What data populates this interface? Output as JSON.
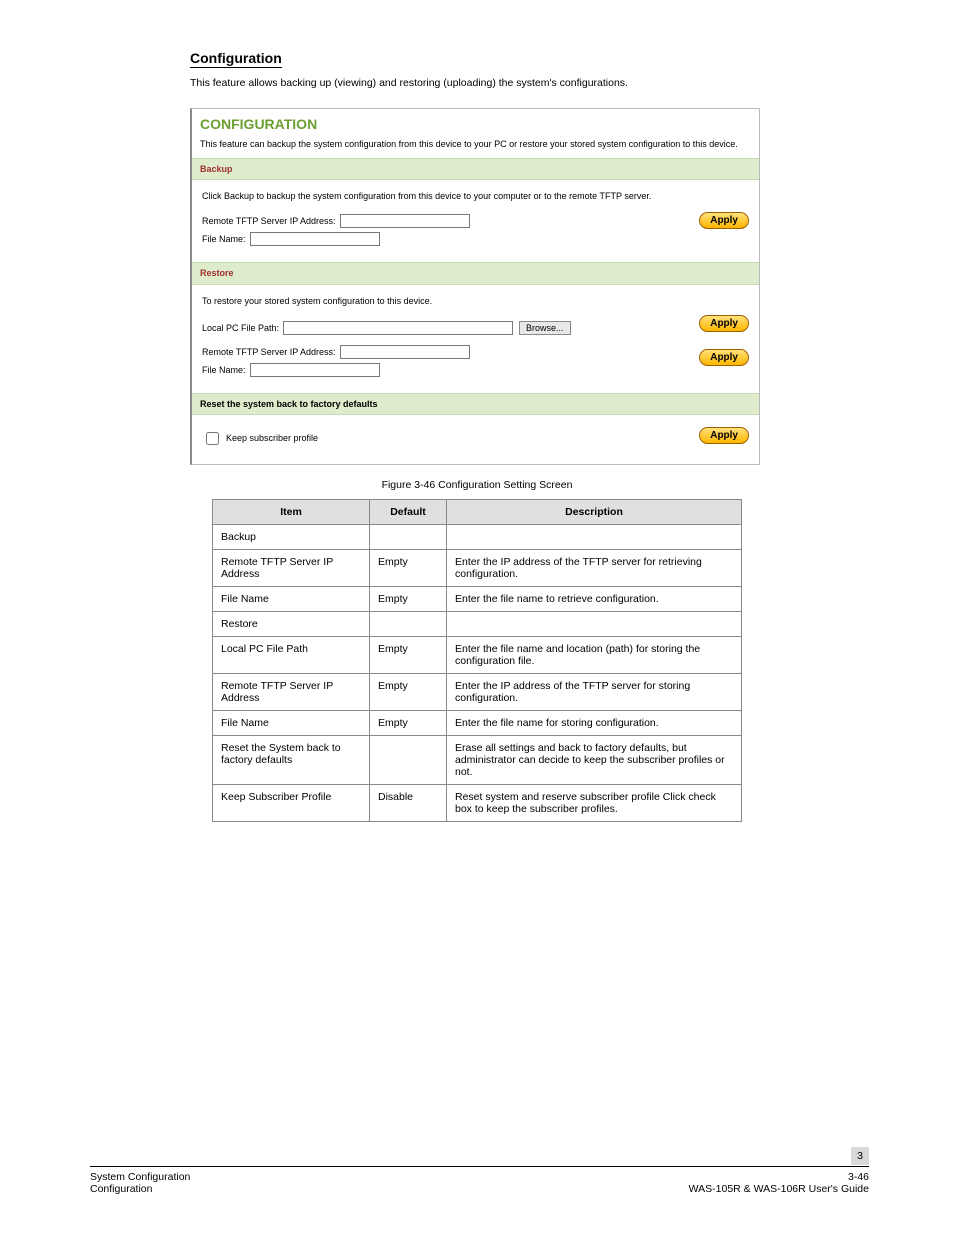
{
  "heading": {
    "title": "Configuration",
    "description": "This feature allows backing up (viewing) and restoring (uploading) the system's configurations."
  },
  "panel": {
    "title": "CONFIGURATION",
    "intro": "This feature can backup the system configuration from this device to your PC or restore your stored system configuration to this device.",
    "backup": {
      "bar": "Backup",
      "desc": "Click Backup to backup the system configuration from this device to your computer or to the remote TFTP server.",
      "tftp_label": "Remote TFTP Server IP Address:",
      "file_label": "File Name:",
      "apply": "Apply"
    },
    "restore": {
      "bar": "Restore",
      "desc": "To restore your stored system configuration to this device.",
      "local_label": "Local PC File Path:",
      "browse": "Browse...",
      "apply1": "Apply",
      "tftp_label": "Remote TFTP Server IP Address:",
      "file_label": "File Name:",
      "apply2": "Apply"
    },
    "reset": {
      "bar": "Reset the system back to factory defaults",
      "keep_label": "Keep subscriber profile",
      "apply": "Apply"
    }
  },
  "figure_caption": "Figure 3-46 Configuration Setting Screen",
  "table": {
    "headers": {
      "item": "Item",
      "default": "Default",
      "description": "Description"
    },
    "rows": [
      {
        "item": "Backup",
        "default": "",
        "description": ""
      },
      {
        "item": "Remote TFTP Server IP Address",
        "default": "Empty",
        "description": "Enter the IP address of the TFTP server for retrieving configuration."
      },
      {
        "item": "File Name",
        "default": "Empty",
        "description": "Enter the file name to retrieve configuration."
      },
      {
        "item": "Restore",
        "default": "",
        "description": ""
      },
      {
        "item": "Local PC File Path",
        "default": "Empty",
        "description": "Enter the file name and location (path) for storing the configuration file."
      },
      {
        "item": "Remote TFTP Server IP Address",
        "default": "Empty",
        "description": "Enter the IP address of the TFTP server for storing configuration."
      },
      {
        "item": "File Name",
        "default": "Empty",
        "description": "Enter the file name for storing configuration."
      },
      {
        "item": "Reset the System back to factory defaults",
        "default": "",
        "description": "Erase all settings and back to factory defaults, but administrator can decide to keep the subscriber profiles or not."
      },
      {
        "item": "Keep Subscriber Profile",
        "default": "Disable",
        "description": "Reset system and reserve subscriber profile Click check box to keep the subscriber profiles."
      }
    ]
  },
  "footer": {
    "left_line1": "System Configuration",
    "left_line2": "Configuration",
    "right_line1": "3-46",
    "right_line2": "WAS-105R & WAS-106R User's Guide",
    "page_num": "3"
  }
}
